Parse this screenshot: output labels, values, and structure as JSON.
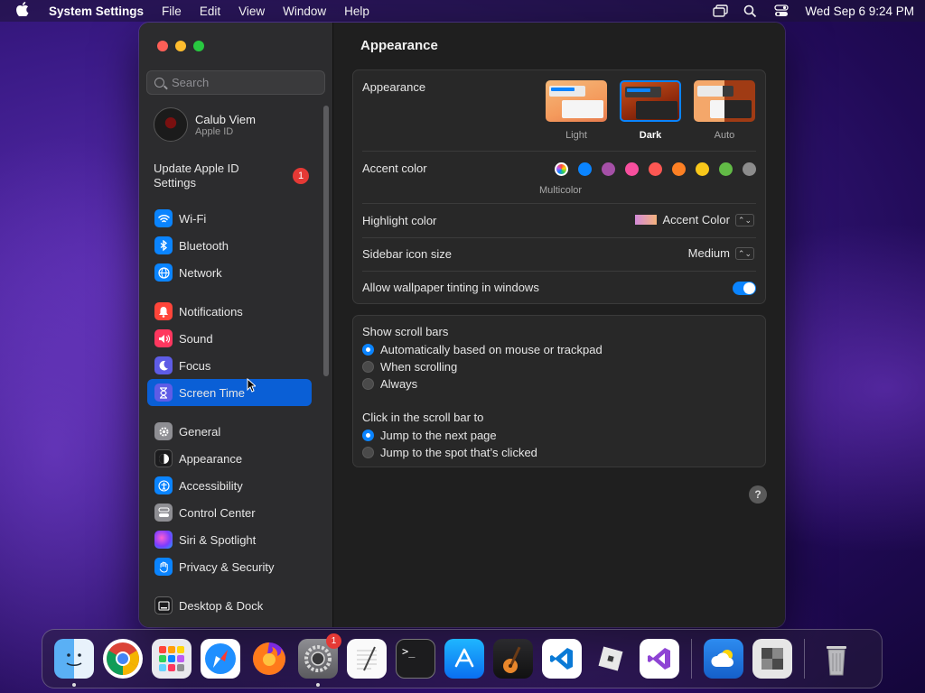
{
  "menubar": {
    "app_name": "System Settings",
    "items": [
      "File",
      "Edit",
      "View",
      "Window",
      "Help"
    ],
    "datetime": "Wed Sep 6  9:24 PM"
  },
  "sidebar": {
    "search_placeholder": "Search",
    "profile": {
      "name": "Calub Viem",
      "subtitle": "Apple ID"
    },
    "update": {
      "label": "Update Apple ID Settings",
      "badge": "1"
    },
    "items": [
      {
        "label": "Wi-Fi",
        "icon": "wifi-icon",
        "color": "#0a84ff"
      },
      {
        "label": "Bluetooth",
        "icon": "bluetooth-icon",
        "color": "#0a84ff"
      },
      {
        "label": "Network",
        "icon": "globe-icon",
        "color": "#0a84ff"
      },
      {
        "label": "Notifications",
        "icon": "bell-icon",
        "color": "#ff453a"
      },
      {
        "label": "Sound",
        "icon": "speaker-icon",
        "color": "#ff375f"
      },
      {
        "label": "Focus",
        "icon": "moon-icon",
        "color": "#5e5ce6"
      },
      {
        "label": "Screen Time",
        "icon": "hourglass-icon",
        "color": "#5e5ce6"
      },
      {
        "label": "General",
        "icon": "gear-icon",
        "color": "#8e8e93"
      },
      {
        "label": "Appearance",
        "icon": "appearance-icon",
        "color": "#1c1c1e"
      },
      {
        "label": "Accessibility",
        "icon": "accessibility-icon",
        "color": "#0a84ff"
      },
      {
        "label": "Control Center",
        "icon": "control-center-icon",
        "color": "#8e8e93"
      },
      {
        "label": "Siri & Spotlight",
        "icon": "siri-icon",
        "color": "#bf5af2"
      },
      {
        "label": "Privacy & Security",
        "icon": "hand-icon",
        "color": "#0a84ff"
      },
      {
        "label": "Desktop & Dock",
        "icon": "dock-icon",
        "color": "#1c1c1e"
      }
    ],
    "selected": "Screen Time"
  },
  "main": {
    "title": "Appearance",
    "appearance": {
      "label": "Appearance",
      "options": [
        "Light",
        "Dark",
        "Auto"
      ],
      "selected": "Dark"
    },
    "accent": {
      "label": "Accent color",
      "selected_name": "Multicolor",
      "colors": [
        "multicolor",
        "#0a84ff",
        "#a550a7",
        "#f74f9e",
        "#fc5753",
        "#fd8024",
        "#f8c71a",
        "#62ba46",
        "#8c8c8c"
      ]
    },
    "highlight": {
      "label": "Highlight color",
      "value": "Accent Color"
    },
    "sidebar_icon_size": {
      "label": "Sidebar icon size",
      "value": "Medium"
    },
    "wallpaper_tinting": {
      "label": "Allow wallpaper tinting in windows",
      "on": true
    },
    "scroll_bars": {
      "label": "Show scroll bars",
      "options": [
        "Automatically based on mouse or trackpad",
        "When scrolling",
        "Always"
      ],
      "selected": 0
    },
    "click_scroll": {
      "label": "Click in the scroll bar to",
      "options": [
        "Jump to the next page",
        "Jump to the spot that’s clicked"
      ],
      "selected": 0
    },
    "help": "?"
  },
  "dock": {
    "apps": [
      "finder-icon",
      "chrome-icon",
      "launchpad-icon",
      "safari-icon",
      "firefox-icon",
      "system-settings-icon",
      "textedit-icon",
      "terminal-icon",
      "app-store-icon",
      "garageband-icon",
      "vscode-icon",
      "roblox-icon",
      "visual-studio-icon",
      "weather-icon",
      "utility-icon",
      "trash-icon"
    ],
    "settings_badge": "1"
  }
}
